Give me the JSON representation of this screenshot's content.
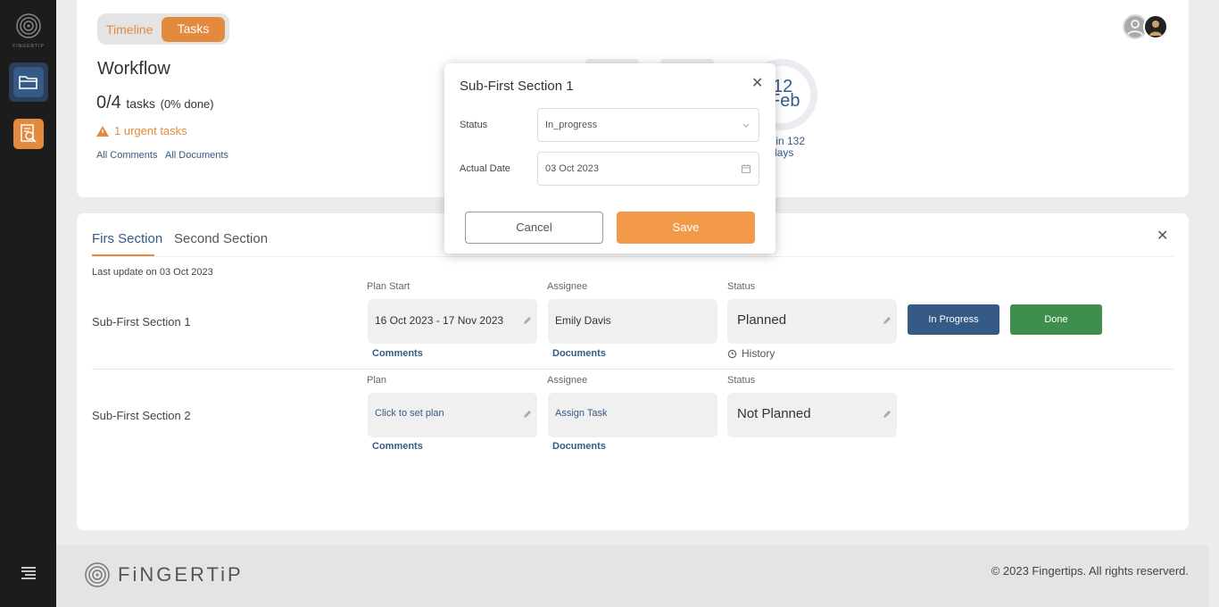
{
  "sidebar": {
    "logo_text": "FINGERTIP",
    "items": [
      {
        "icon": "folder-open-icon"
      },
      {
        "icon": "search-document-icon"
      }
    ],
    "menu_icon": "menu-icon"
  },
  "header": {
    "toggle": {
      "timeline_label": "Timeline",
      "tasks_label": "Tasks",
      "active": "Tasks"
    },
    "title": "Workflow",
    "count": "0/4",
    "count_unit": "tasks",
    "done_pct": "(0% done)",
    "urgent_text": "1 urgent tasks",
    "all_comments": "All Comments",
    "all_documents": "All Documents",
    "date_day": "12",
    "date_month": "Feb",
    "delivery_line1": "ry in 132",
    "delivery_line2": "days"
  },
  "tabs": [
    {
      "label": "Firs Section",
      "active": true
    },
    {
      "label": "Second Section",
      "active": false
    }
  ],
  "last_update": "Last update on 03 Oct 2023",
  "rows": [
    {
      "title": "Sub-First Section 1",
      "plan_label": "Plan Start",
      "plan_value": "16 Oct 2023 - 17 Nov 2023",
      "assignee_label": "Assignee",
      "assignee_value": "Emily Davis",
      "status_label": "Status",
      "status_value": "Planned",
      "comments": "Comments",
      "documents": "Documents",
      "history": "History",
      "btn_in_progress": "In Progress",
      "btn_done": "Done"
    },
    {
      "title": "Sub-First Section 2",
      "plan_label": "Plan",
      "plan_value": "Click to set plan",
      "assignee_label": "Assignee",
      "assignee_value": "Assign Task",
      "status_label": "Status",
      "status_value": "Not Planned",
      "comments": "Comments",
      "documents": "Documents"
    }
  ],
  "modal": {
    "title": "Sub-First Section 1",
    "status_label": "Status",
    "status_value": "In_progress",
    "date_label": "Actual Date",
    "date_value": "03 Oct 2023",
    "cancel": "Cancel",
    "save": "Save"
  },
  "footer": {
    "logo_name": "FiNGERTiP",
    "copyright": "© 2023 Fingertips. All rights reserverd."
  },
  "colors": {
    "accent": "#e38a3e",
    "primary": "#355a86",
    "success": "#3e8e4e",
    "sidebar": "#1c1c1c"
  }
}
